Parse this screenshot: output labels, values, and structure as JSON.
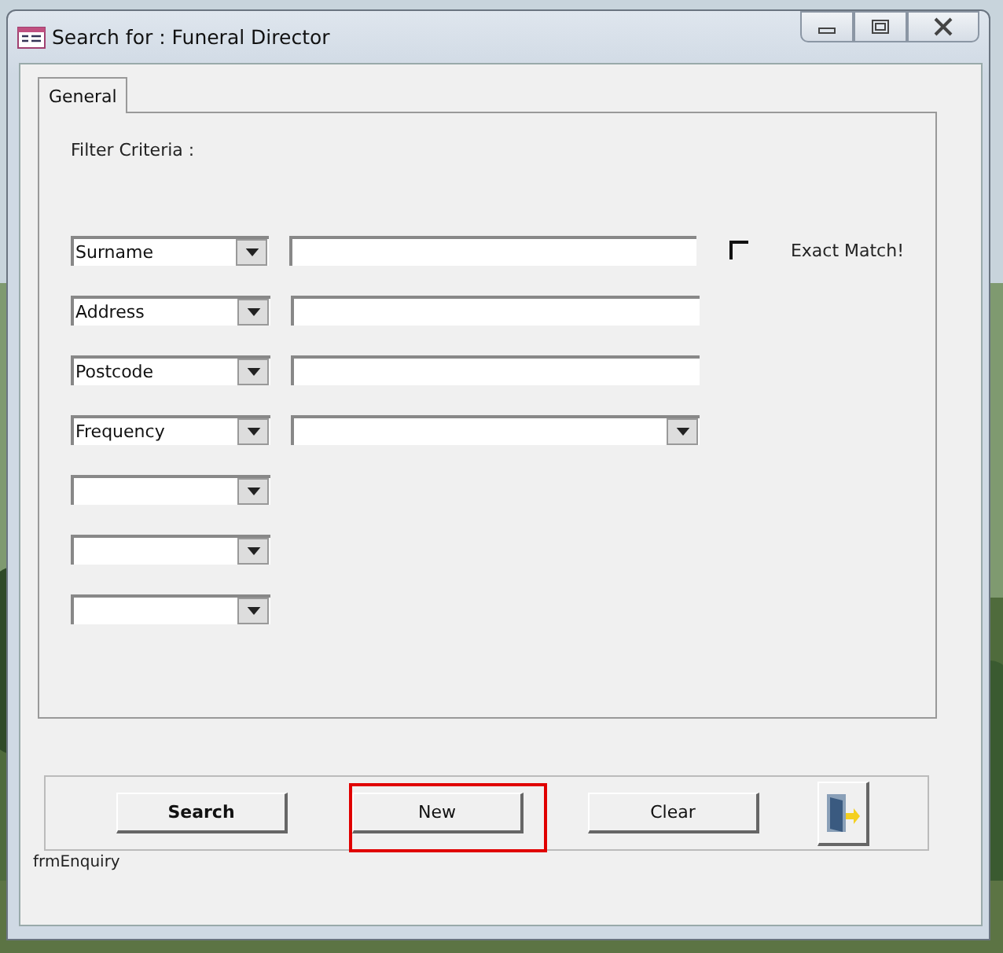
{
  "window": {
    "title": "Search for : Funeral Director"
  },
  "tabs": [
    {
      "label": "General",
      "selected": true
    }
  ],
  "filter_label": "Filter Criteria :",
  "rows": [
    {
      "field": "Surname",
      "kind": "text",
      "value": ""
    },
    {
      "field": "Address",
      "kind": "text",
      "value": ""
    },
    {
      "field": "Postcode",
      "kind": "text",
      "value": ""
    },
    {
      "field": "Frequency",
      "kind": "combo",
      "value": ""
    },
    {
      "field": "",
      "kind": "none"
    },
    {
      "field": "",
      "kind": "none"
    },
    {
      "field": "",
      "kind": "none"
    }
  ],
  "exact_match": {
    "label": "Exact Match!",
    "checked": false
  },
  "buttons": [
    {
      "label": "Search",
      "kind": "text",
      "bold": true,
      "highlighted": false
    },
    {
      "label": "New",
      "kind": "text",
      "bold": false,
      "highlighted": true
    },
    {
      "label": "Clear",
      "kind": "text",
      "bold": false,
      "highlighted": false
    },
    {
      "kind": "exit",
      "highlighted": false
    }
  ],
  "form_name": "frmEnquiry"
}
